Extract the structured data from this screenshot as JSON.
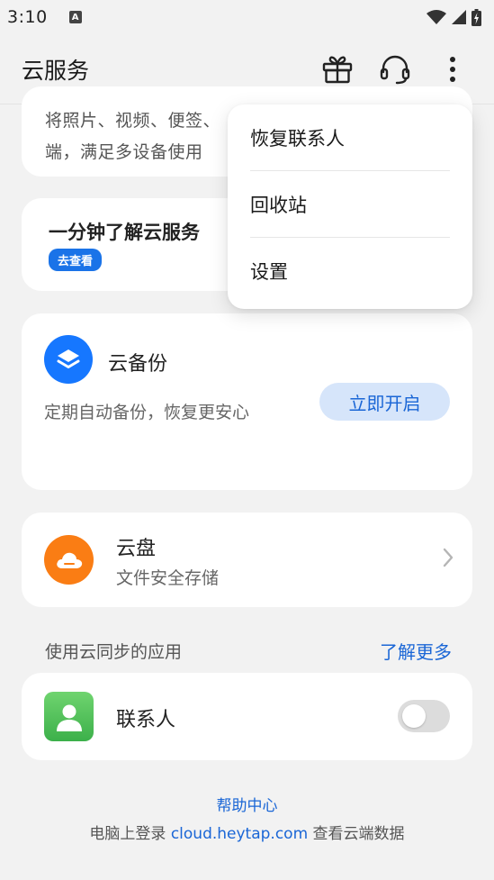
{
  "status_bar": {
    "time": "3:10",
    "notification_letter": "A"
  },
  "header": {
    "title": "云服务",
    "icons": [
      "gift-icon",
      "headset-icon",
      "more-vertical-icon"
    ]
  },
  "feature_card": {
    "line1": "将照片、视频、便签、",
    "line2": "端，满足多设备使用"
  },
  "intro_card": {
    "title": "一分钟了解云服务",
    "badge": "去查看"
  },
  "backup_card": {
    "title": "云备份",
    "subtitle": "定期自动备份，恢复更安心",
    "button": "立即开启",
    "icon": "layers-icon",
    "accent": "#1677ff"
  },
  "disk_card": {
    "title": "云盘",
    "subtitle": "文件安全存储",
    "icon": "cloud-icon",
    "accent": "#fa7d14"
  },
  "sync_section": {
    "label": "使用云同步的应用",
    "more": "了解更多"
  },
  "contacts_card": {
    "title": "联系人",
    "toggle_on": false
  },
  "footer": {
    "help": "帮助中心",
    "prefix": "电脑上登录 ",
    "url": "cloud.heytap.com",
    "suffix": " 查看云端数据"
  },
  "menu": {
    "items": [
      {
        "label": "恢复联系人"
      },
      {
        "label": "回收站"
      },
      {
        "label": "设置"
      }
    ]
  }
}
